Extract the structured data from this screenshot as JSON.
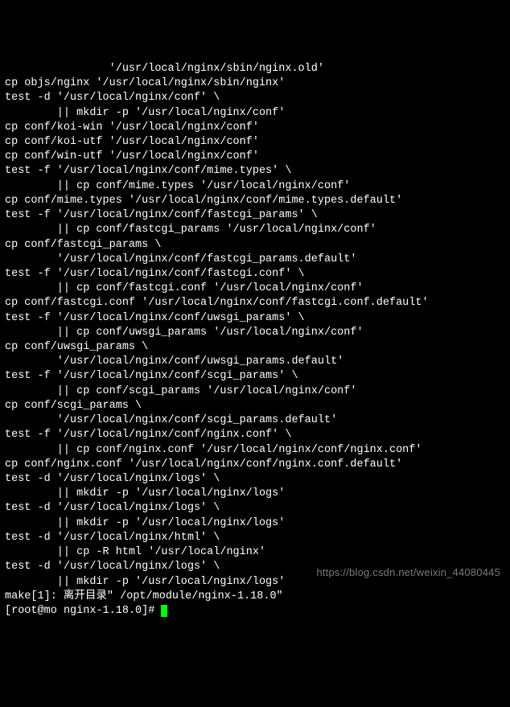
{
  "terminal": {
    "lines": [
      "                '/usr/local/nginx/sbin/nginx.old'",
      "cp objs/nginx '/usr/local/nginx/sbin/nginx'",
      "test -d '/usr/local/nginx/conf' \\",
      "        || mkdir -p '/usr/local/nginx/conf'",
      "cp conf/koi-win '/usr/local/nginx/conf'",
      "cp conf/koi-utf '/usr/local/nginx/conf'",
      "cp conf/win-utf '/usr/local/nginx/conf'",
      "test -f '/usr/local/nginx/conf/mime.types' \\",
      "        || cp conf/mime.types '/usr/local/nginx/conf'",
      "cp conf/mime.types '/usr/local/nginx/conf/mime.types.default'",
      "test -f '/usr/local/nginx/conf/fastcgi_params' \\",
      "        || cp conf/fastcgi_params '/usr/local/nginx/conf'",
      "cp conf/fastcgi_params \\",
      "        '/usr/local/nginx/conf/fastcgi_params.default'",
      "test -f '/usr/local/nginx/conf/fastcgi.conf' \\",
      "        || cp conf/fastcgi.conf '/usr/local/nginx/conf'",
      "cp conf/fastcgi.conf '/usr/local/nginx/conf/fastcgi.conf.default'",
      "test -f '/usr/local/nginx/conf/uwsgi_params' \\",
      "        || cp conf/uwsgi_params '/usr/local/nginx/conf'",
      "cp conf/uwsgi_params \\",
      "        '/usr/local/nginx/conf/uwsgi_params.default'",
      "test -f '/usr/local/nginx/conf/scgi_params' \\",
      "        || cp conf/scgi_params '/usr/local/nginx/conf'",
      "cp conf/scgi_params \\",
      "        '/usr/local/nginx/conf/scgi_params.default'",
      "test -f '/usr/local/nginx/conf/nginx.conf' \\",
      "        || cp conf/nginx.conf '/usr/local/nginx/conf/nginx.conf'",
      "cp conf/nginx.conf '/usr/local/nginx/conf/nginx.conf.default'",
      "test -d '/usr/local/nginx/logs' \\",
      "        || mkdir -p '/usr/local/nginx/logs'",
      "test -d '/usr/local/nginx/logs' \\",
      "        || mkdir -p '/usr/local/nginx/logs'",
      "test -d '/usr/local/nginx/html' \\",
      "        || cp -R html '/usr/local/nginx'",
      "test -d '/usr/local/nginx/logs' \\",
      "        || mkdir -p '/usr/local/nginx/logs'",
      "make[1]: 离开目录\" /opt/module/nginx-1.18.0\""
    ],
    "prompt": {
      "user_host": "root@mo",
      "cwd": "nginx-1.18.0",
      "symbol": "#"
    }
  },
  "watermark": "https://blog.csdn.net/weixin_44080445"
}
